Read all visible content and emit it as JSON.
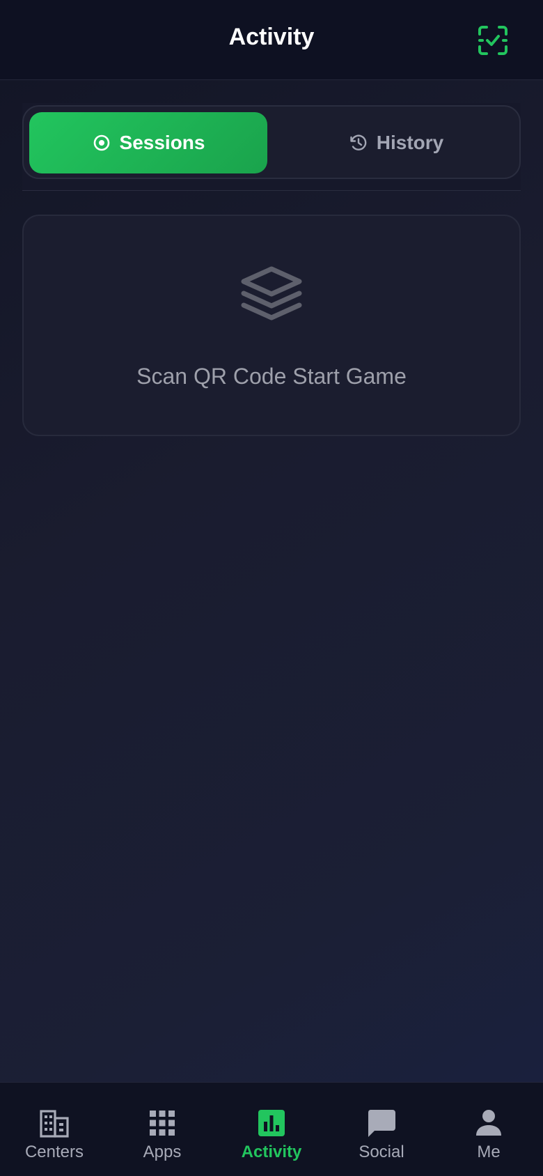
{
  "header": {
    "title": "Activity",
    "scan_icon": "scan-check-icon"
  },
  "tabs": [
    {
      "label": "Sessions",
      "icon": "target-icon",
      "active": true
    },
    {
      "label": "History",
      "icon": "history-icon",
      "active": false
    }
  ],
  "empty_state": {
    "icon": "layers-icon",
    "message": "Scan QR Code Start Game"
  },
  "bottom_nav": [
    {
      "label": "Centers",
      "icon": "building-icon",
      "active": false
    },
    {
      "label": "Apps",
      "icon": "grid-icon",
      "active": false
    },
    {
      "label": "Activity",
      "icon": "bar-chart-icon",
      "active": true
    },
    {
      "label": "Social",
      "icon": "chat-icon",
      "active": false
    },
    {
      "label": "Me",
      "icon": "person-icon",
      "active": false
    }
  ],
  "colors": {
    "accent": "#22c55e",
    "background": "#1a1c2f",
    "header_bg": "#0e1122",
    "text_muted": "#a8abb8"
  }
}
